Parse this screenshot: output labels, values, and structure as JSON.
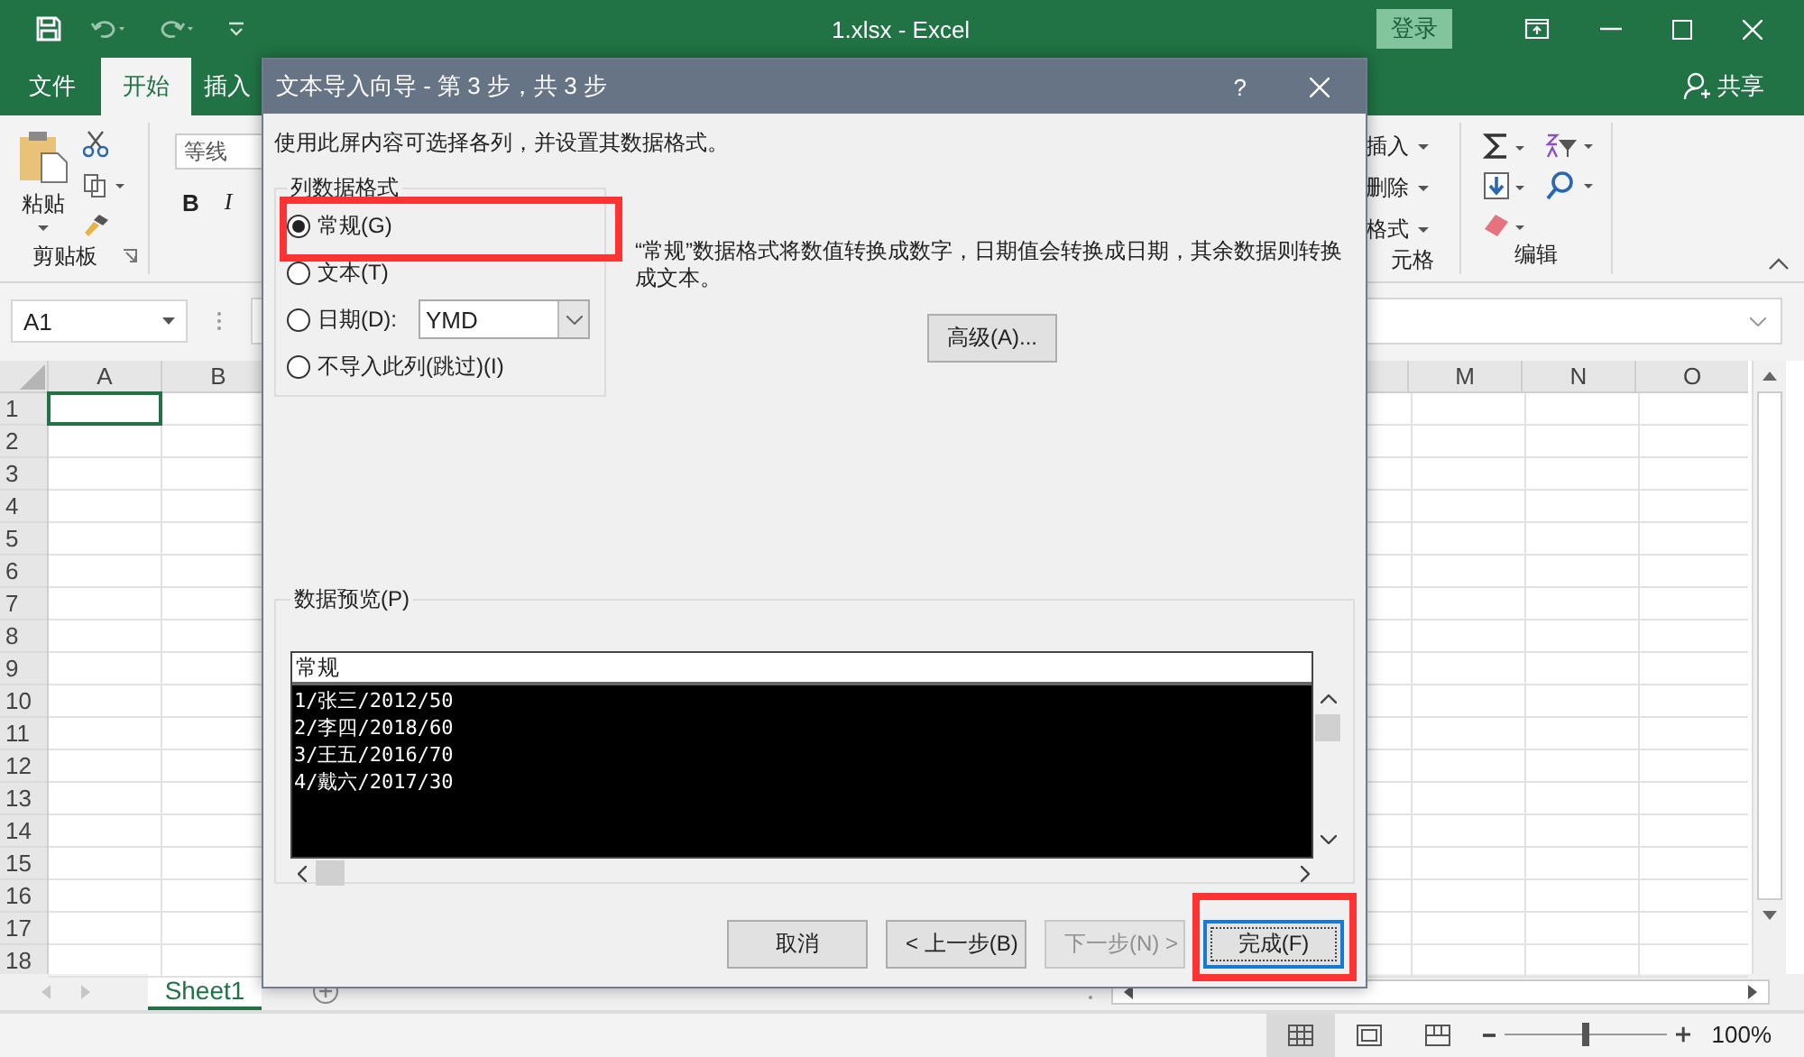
{
  "window": {
    "title": "1.xlsx - Excel",
    "sign_in": "登录"
  },
  "ribbon_tabs": [
    {
      "label": "文件",
      "selected": false
    },
    {
      "label": "开始",
      "selected": true
    },
    {
      "label": "插入",
      "selected": false
    }
  ],
  "share": "共享",
  "clipboard": {
    "paste": "粘贴",
    "group": "剪贴板"
  },
  "font": {
    "name": "等线",
    "bold": "B",
    "italic": "I"
  },
  "cells_group": {
    "items": [
      "插入",
      "删除",
      "格式"
    ],
    "group": "元格"
  },
  "editing": {
    "group": "编辑"
  },
  "name_box": "A1",
  "columns_left": [
    "A",
    "B"
  ],
  "columns_right": [
    "M",
    "N",
    "O"
  ],
  "rows": [
    "1",
    "2",
    "3",
    "4",
    "5",
    "6",
    "7",
    "8",
    "9",
    "10",
    "11",
    "12",
    "13",
    "14",
    "15",
    "16",
    "17",
    "18"
  ],
  "sheets": [
    {
      "label": "Sheet1",
      "selected": true
    }
  ],
  "views": [
    {
      "kind": "normal",
      "selected": true
    },
    {
      "kind": "layout",
      "selected": false
    },
    {
      "kind": "break",
      "selected": false
    }
  ],
  "zoom": {
    "level": 0.5,
    "reading": "100%"
  },
  "dialog": {
    "title": "文本导入向导 - 第 3 步，共 3 步",
    "help": "?",
    "intro": "使用此屏内容可选择各列，并设置其数据格式。",
    "format_group": {
      "title": "列数据格式",
      "options": [
        {
          "kind": "plain",
          "label": "常规(G)",
          "selected": true,
          "highlighted": true
        },
        {
          "kind": "plain",
          "label": "文本(T)",
          "selected": false,
          "highlighted": false
        },
        {
          "kind": "date",
          "label": "日期(D):",
          "value": "YMD",
          "selected": false,
          "highlighted": false
        },
        {
          "kind": "plain",
          "label": "不导入此列(跳过)(I)",
          "selected": false,
          "highlighted": false
        }
      ]
    },
    "description": "“常规”数据格式将数值转换成数字，日期值会转换成日期，其余数据则转换成文本。",
    "advanced_button": "高级(A)...",
    "preview": {
      "title": "数据预览(P)",
      "header": "常规",
      "lines": [
        "1/张三/2012/50",
        "2/李四/2018/60",
        "3/王五/2016/70",
        "4/戴六/2017/30"
      ]
    },
    "buttons": [
      {
        "label": "取消",
        "disabled": false,
        "default": false,
        "highlighted": false
      },
      {
        "label": "< 上一步(B)",
        "disabled": false,
        "default": false,
        "highlighted": false
      },
      {
        "label": "下一步(N) >",
        "disabled": true,
        "default": false,
        "highlighted": false
      },
      {
        "label": "完成(F)",
        "disabled": false,
        "default": true,
        "highlighted": true
      }
    ]
  }
}
